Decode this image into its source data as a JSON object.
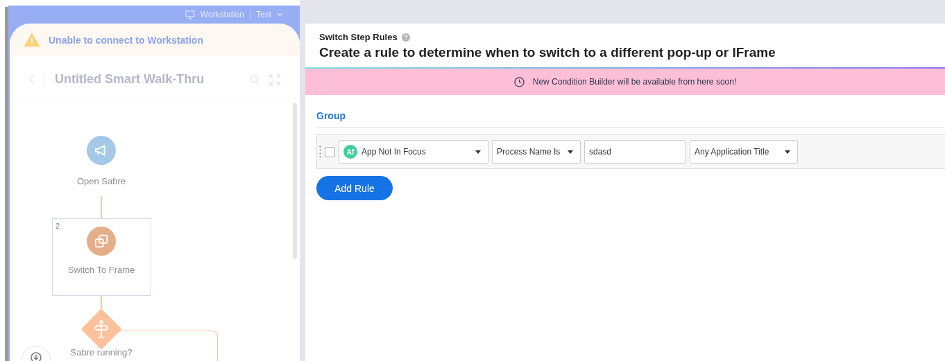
{
  "top_bar": {
    "device": "Workstation",
    "environment": "Test"
  },
  "warning": {
    "text": "Unable to connect to Workstation"
  },
  "walkthru": {
    "title": "Untitled Smart Walk-Thru"
  },
  "flow": [
    {
      "kind": "circle",
      "label": "Open Sabre"
    },
    {
      "kind": "box",
      "number": "2",
      "label": "Switch To Frame"
    },
    {
      "kind": "diamond",
      "label": "Sabre running?"
    }
  ],
  "rules": {
    "section_label": "Switch Step Rules",
    "heading": "Create a rule to determine when to switch to a different pop-up or IFrame",
    "notice": "New Condition Builder will be available from here soon!",
    "group_label": "Group",
    "rows": [
      {
        "checked": false,
        "badge": "Af",
        "condition": "App Not In Focus",
        "operator": "Process Name Is",
        "value": "sdasd",
        "title_filter": "Any Application Title"
      }
    ],
    "add_button": "Add Rule"
  }
}
